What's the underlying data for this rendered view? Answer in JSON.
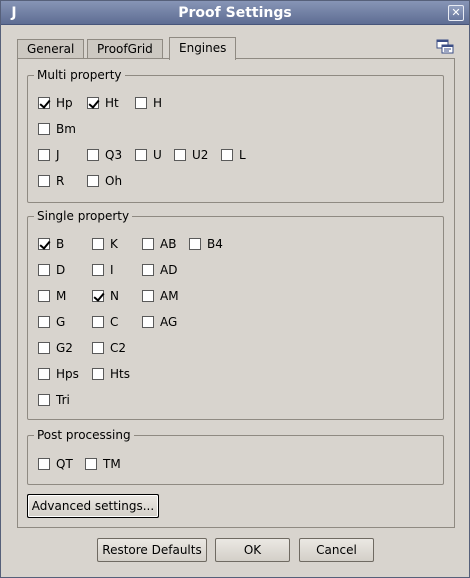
{
  "window": {
    "title": "Proof Settings",
    "app_icon_letter": "J",
    "close_glyph": "✕"
  },
  "tabs": [
    {
      "label": "General",
      "active": false
    },
    {
      "label": "ProofGrid",
      "active": false
    },
    {
      "label": "Engines",
      "active": true
    }
  ],
  "multi_property": {
    "label": "Multi property",
    "options": [
      {
        "label": "Hp",
        "checked": true
      },
      {
        "label": "Ht",
        "checked": true
      },
      {
        "label": "H",
        "checked": false
      },
      {
        "label": "Bm",
        "checked": false
      },
      {
        "label": "J",
        "checked": false
      },
      {
        "label": "Q3",
        "checked": false
      },
      {
        "label": "U",
        "checked": false
      },
      {
        "label": "U2",
        "checked": false
      },
      {
        "label": "L",
        "checked": false
      },
      {
        "label": "R",
        "checked": false
      },
      {
        "label": "Oh",
        "checked": false
      }
    ]
  },
  "single_property": {
    "label": "Single property",
    "options": [
      {
        "label": "B",
        "checked": true
      },
      {
        "label": "K",
        "checked": false
      },
      {
        "label": "AB",
        "checked": false
      },
      {
        "label": "B4",
        "checked": false
      },
      {
        "label": "D",
        "checked": false
      },
      {
        "label": "I",
        "checked": false
      },
      {
        "label": "AD",
        "checked": false
      },
      {
        "label": "M",
        "checked": false
      },
      {
        "label": "N",
        "checked": true
      },
      {
        "label": "AM",
        "checked": false
      },
      {
        "label": "G",
        "checked": false
      },
      {
        "label": "C",
        "checked": false
      },
      {
        "label": "AG",
        "checked": false
      },
      {
        "label": "G2",
        "checked": false
      },
      {
        "label": "C2",
        "checked": false
      },
      {
        "label": "Hps",
        "checked": false
      },
      {
        "label": "Hts",
        "checked": false
      },
      {
        "label": "Tri",
        "checked": false
      }
    ]
  },
  "post_processing": {
    "label": "Post processing",
    "options": [
      {
        "label": "QT",
        "checked": false
      },
      {
        "label": "TM",
        "checked": false
      }
    ]
  },
  "buttons": {
    "advanced": "Advanced settings...",
    "restore": "Restore Defaults",
    "ok": "OK",
    "cancel": "Cancel"
  },
  "icons": {
    "tab_corner": "window-list-icon"
  }
}
